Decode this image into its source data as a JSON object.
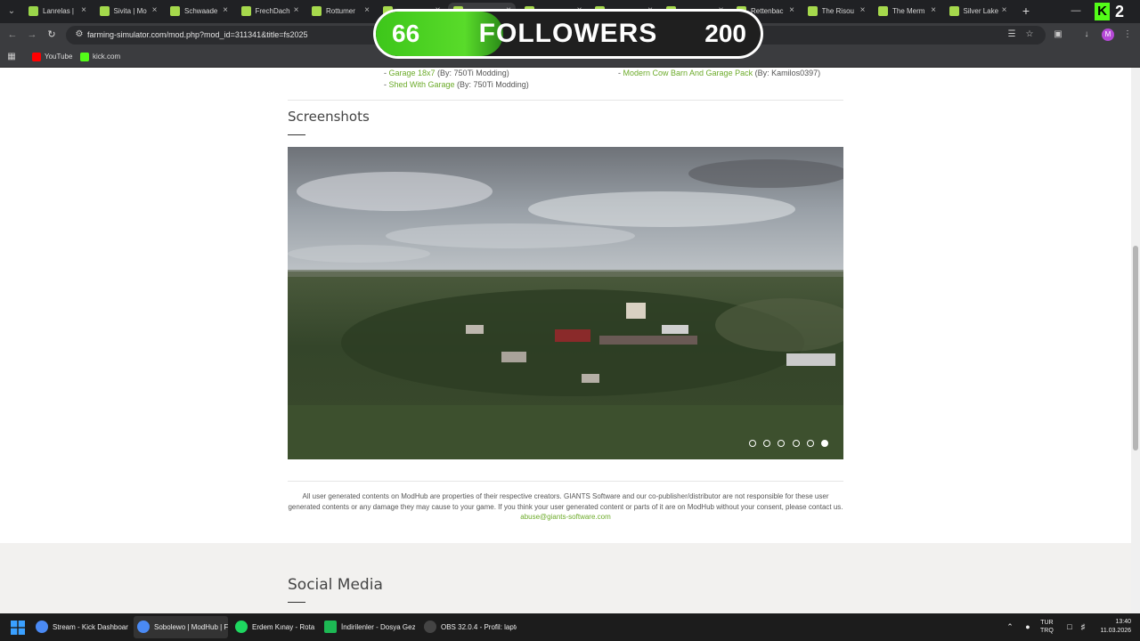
{
  "browser": {
    "tabs": [
      {
        "title": "Lanrelas |",
        "icon": "farming-simulator-icon",
        "active": false
      },
      {
        "title": "Sivita | Mo",
        "icon": "farming-simulator-icon",
        "active": false
      },
      {
        "title": "Schwaade",
        "icon": "farming-simulator-icon",
        "active": false
      },
      {
        "title": "FrechDach",
        "icon": "farming-simulator-icon",
        "active": false
      },
      {
        "title": "Rottumer",
        "icon": "farming-simulator-icon",
        "active": false
      },
      {
        "title": "",
        "icon": "farming-simulator-icon",
        "active": false
      },
      {
        "title": "",
        "icon": "farming-simulator-icon",
        "active": true
      },
      {
        "title": "",
        "icon": "farming-simulator-icon",
        "active": false
      },
      {
        "title": "",
        "icon": "farming-simulator-icon",
        "active": false
      },
      {
        "title": "",
        "icon": "farming-simulator-icon",
        "active": false
      },
      {
        "title": "Rettenbac",
        "icon": "farming-simulator-icon",
        "active": false
      },
      {
        "title": "The Risou",
        "icon": "farming-simulator-icon",
        "active": false
      },
      {
        "title": "The Merm",
        "icon": "farming-simulator-icon",
        "active": false
      },
      {
        "title": "Silver Lake",
        "icon": "farming-simulator-icon",
        "active": false
      }
    ],
    "url": "farming-simulator.com/mod.php?mod_id=311341&title=fs2025",
    "bookmarks": [
      {
        "label": "YouTube",
        "icon": "youtube-icon",
        "color": "#ff0000"
      },
      {
        "label": "kick.com",
        "icon": "kick-icon",
        "color": "#53fc18"
      }
    ],
    "kick_counter": "2"
  },
  "overlay": {
    "current": "66",
    "label": "FOLLOWERS",
    "goal": "200",
    "progress_fraction": 0.33,
    "color": "#53fc18"
  },
  "page": {
    "required_mods_left": [
      {
        "prefix": "- ",
        "name": "Garage 18x7",
        "author": " (By: 750Ti Modding)"
      },
      {
        "prefix": "- ",
        "name": "Shed With Garage",
        "author": " (By: 750Ti Modding)"
      }
    ],
    "required_mods_right": [
      {
        "prefix": "- ",
        "name": "Modern Cow Barn And Garage Pack",
        "author": " (By: Kamilos0397)"
      }
    ],
    "screenshots_heading": "Screenshots",
    "slider": {
      "count": 6,
      "active_index": 5
    },
    "disclaimer_line1": "All user generated contents on ModHub are properties of their respective creators. GIANTS Software and our co-publisher/distributor are not responsible for these user",
    "disclaimer_line2": "generated contents or any damage they may cause to your game. If you think your user generated content or parts of it are on ModHub without your consent, please contact us.",
    "disclaimer_email": "abuse@giants-software.com",
    "social_heading": "Social Media",
    "link_color": "#6cab2a"
  },
  "taskbar": {
    "items": [
      {
        "label": "Stream - Kick Dashboar",
        "icon": "chrome-icon",
        "active": false
      },
      {
        "label": "Sobolewo | ModHub | F",
        "icon": "chrome-icon",
        "active": true
      },
      {
        "label": "Erdem Kınay - Rota",
        "icon": "spotify-icon",
        "active": false
      },
      {
        "label": "İndirilenler - Dosya Gez",
        "icon": "file-explorer-icon",
        "active": false
      },
      {
        "label": "OBS 32.0.4 - Profil: laptc",
        "icon": "obs-icon",
        "active": false
      }
    ],
    "language_top": "TUR",
    "language_bottom": "TRQ",
    "time": "13:40",
    "date": "11.03.2026"
  }
}
